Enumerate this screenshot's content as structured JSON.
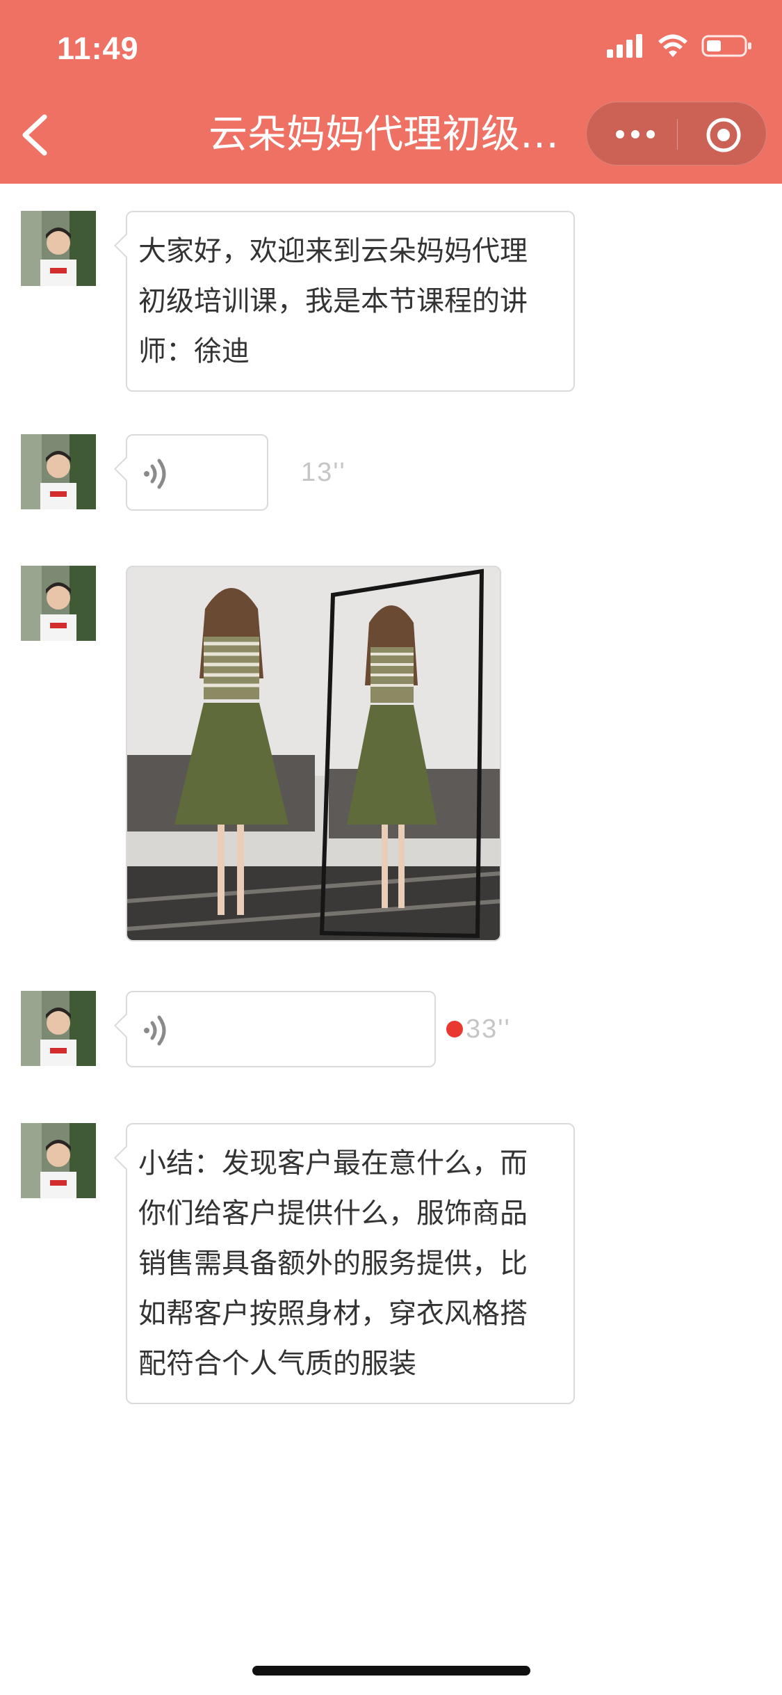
{
  "status_bar": {
    "time": "11:49"
  },
  "nav": {
    "title": "云朵妈妈代理初级…"
  },
  "messages": [
    {
      "type": "text",
      "text_lines": [
        "大家好，欢迎来到云朵妈妈代理",
        "初级培训课，我是本节课程的讲",
        "师：徐迪"
      ]
    },
    {
      "type": "voice",
      "duration": "13''",
      "unread": false
    },
    {
      "type": "image"
    },
    {
      "type": "voice",
      "duration": "33''",
      "unread": true
    },
    {
      "type": "text",
      "text_lines": [
        "小结：发现客户最在意什么，而",
        "你们给客户提供什么，服饰商品",
        "销售需具备额外的服务提供，比",
        "如帮客户按照身材，穿衣风格搭",
        "配符合个人气质的服装"
      ]
    }
  ],
  "colors": {
    "header_bg": "#EE7164",
    "bubble_border": "#DADADA",
    "duration_text": "#C5C5C5",
    "unread_dot": "#E8382F"
  },
  "icons": {
    "back": "chevron-left-icon",
    "more": "more-dots-icon",
    "target": "target-icon",
    "voice": "voice-waves-icon",
    "signal": "signal-icon",
    "wifi": "wifi-icon",
    "battery": "battery-icon"
  }
}
